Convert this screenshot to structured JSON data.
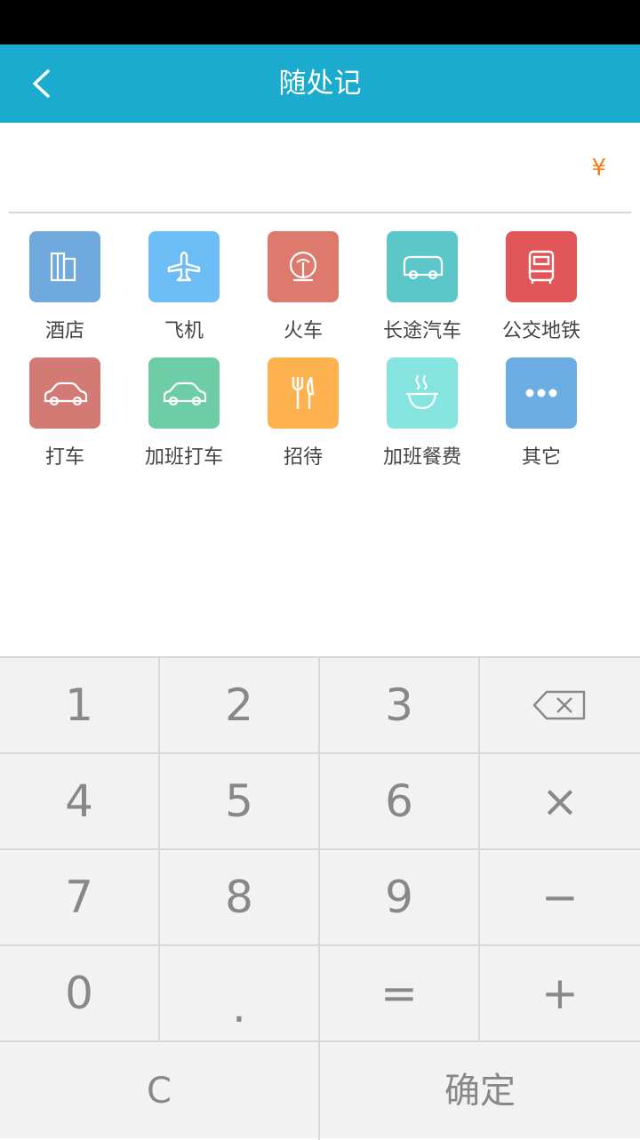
{
  "header": {
    "title": "随处记"
  },
  "amount": {
    "currency": "¥",
    "value": ""
  },
  "categories": [
    {
      "label": "酒店",
      "icon": "hotel-icon",
      "color": "#6fa9de"
    },
    {
      "label": "飞机",
      "icon": "airplane-icon",
      "color": "#6cbcf6"
    },
    {
      "label": "火车",
      "icon": "train-icon",
      "color": "#de7a6d"
    },
    {
      "label": "长途汽车",
      "icon": "coach-bus-icon",
      "color": "#5cc7c9"
    },
    {
      "label": "公交地铁",
      "icon": "bus-subway-icon",
      "color": "#e05659"
    },
    {
      "label": "打车",
      "icon": "taxi-icon",
      "color": "#d47a74"
    },
    {
      "label": "加班打车",
      "icon": "overtime-taxi-icon",
      "color": "#6ccda7"
    },
    {
      "label": "招待",
      "icon": "dining-icon",
      "color": "#fdb24f"
    },
    {
      "label": "加班餐费",
      "icon": "overtime-meal-icon",
      "color": "#86e4e0"
    },
    {
      "label": "其它",
      "icon": "more-icon",
      "color": "#6caee3"
    }
  ],
  "keypad": {
    "k1": "1",
    "k2": "2",
    "k3": "3",
    "backspace": "⌫",
    "k4": "4",
    "k5": "5",
    "k6": "6",
    "multiply": "×",
    "k7": "7",
    "k8": "8",
    "k9": "9",
    "minus": "−",
    "k0": "0",
    "dot": ".",
    "equals": "=",
    "plus": "+",
    "clear": "C",
    "confirm": "确定"
  },
  "colors": {
    "appbar": "#1aabcf",
    "currency": "#f47b16",
    "keypad_bg": "#f2f2f2"
  }
}
